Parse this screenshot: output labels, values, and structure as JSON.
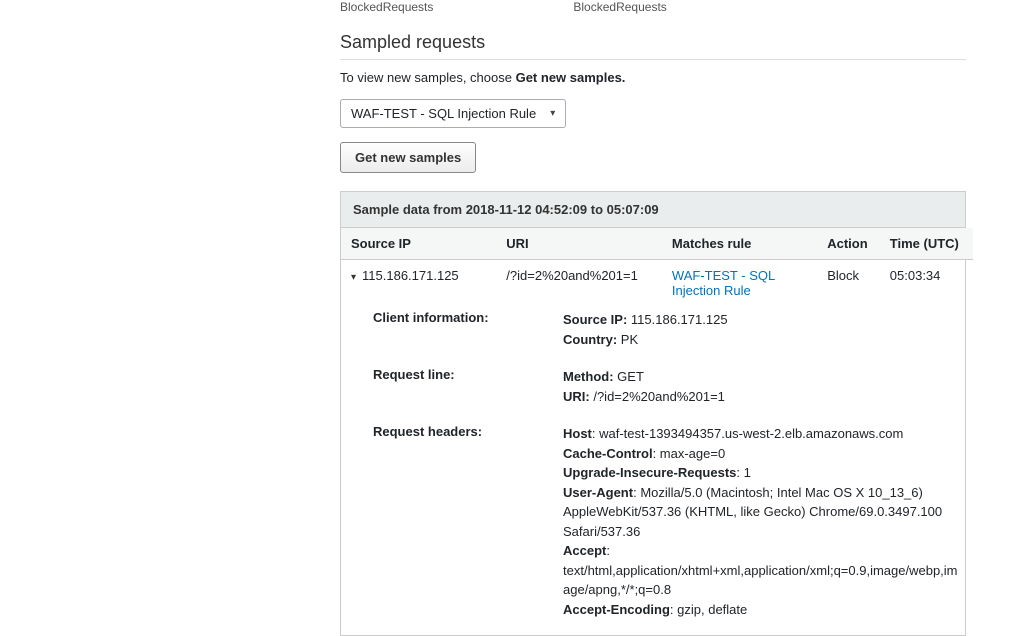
{
  "top_truncated": {
    "a": "BlockedRequests",
    "b": "BlockedRequests"
  },
  "section_title": "Sampled requests",
  "hint_prefix": "To view new samples, choose ",
  "hint_bold": "Get new samples.",
  "rule_select": {
    "selected": "WAF-TEST - SQL Injection Rule"
  },
  "get_samples_btn": "Get new samples",
  "panel_header": "Sample data from 2018-11-12 04:52:09 to 05:07:09",
  "columns": {
    "ip": "Source IP",
    "uri": "URI",
    "rule": "Matches rule",
    "action": "Action",
    "time": "Time (UTC)"
  },
  "row": {
    "ip": "115.186.171.125",
    "uri": "/?id=2%20and%201=1",
    "rule": "WAF-TEST - SQL Injection Rule",
    "action": "Block",
    "time": "05:03:34"
  },
  "details": {
    "client_info": {
      "label": "Client information:",
      "source_ip_k": "Source IP:",
      "source_ip_v": "115.186.171.125",
      "country_k": "Country:",
      "country_v": "PK"
    },
    "request_line": {
      "label": "Request line:",
      "method_k": "Method:",
      "method_v": "GET",
      "uri_k": "URI:",
      "uri_v": "/?id=2%20and%201=1"
    },
    "headers": {
      "label": "Request headers:",
      "host_k": "Host",
      "host_v": "waf-test-1393494357.us-west-2.elb.amazonaws.com",
      "cc_k": "Cache-Control",
      "cc_v": "max-age=0",
      "uir_k": "Upgrade-Insecure-Requests",
      "uir_v": "1",
      "ua_k": "User-Agent",
      "ua_v": "Mozilla/5.0 (Macintosh; Intel Mac OS X 10_13_6) AppleWebKit/537.36 (KHTML, like Gecko) Chrome/69.0.3497.100 Safari/537.36",
      "accept_k": "Accept",
      "accept_v": "text/html,application/xhtml+xml,application/xml;q=0.9,image/webp,image/apng,*/*;q=0.8",
      "ae_k": "Accept-Encoding",
      "ae_v": "gzip, deflate"
    }
  }
}
